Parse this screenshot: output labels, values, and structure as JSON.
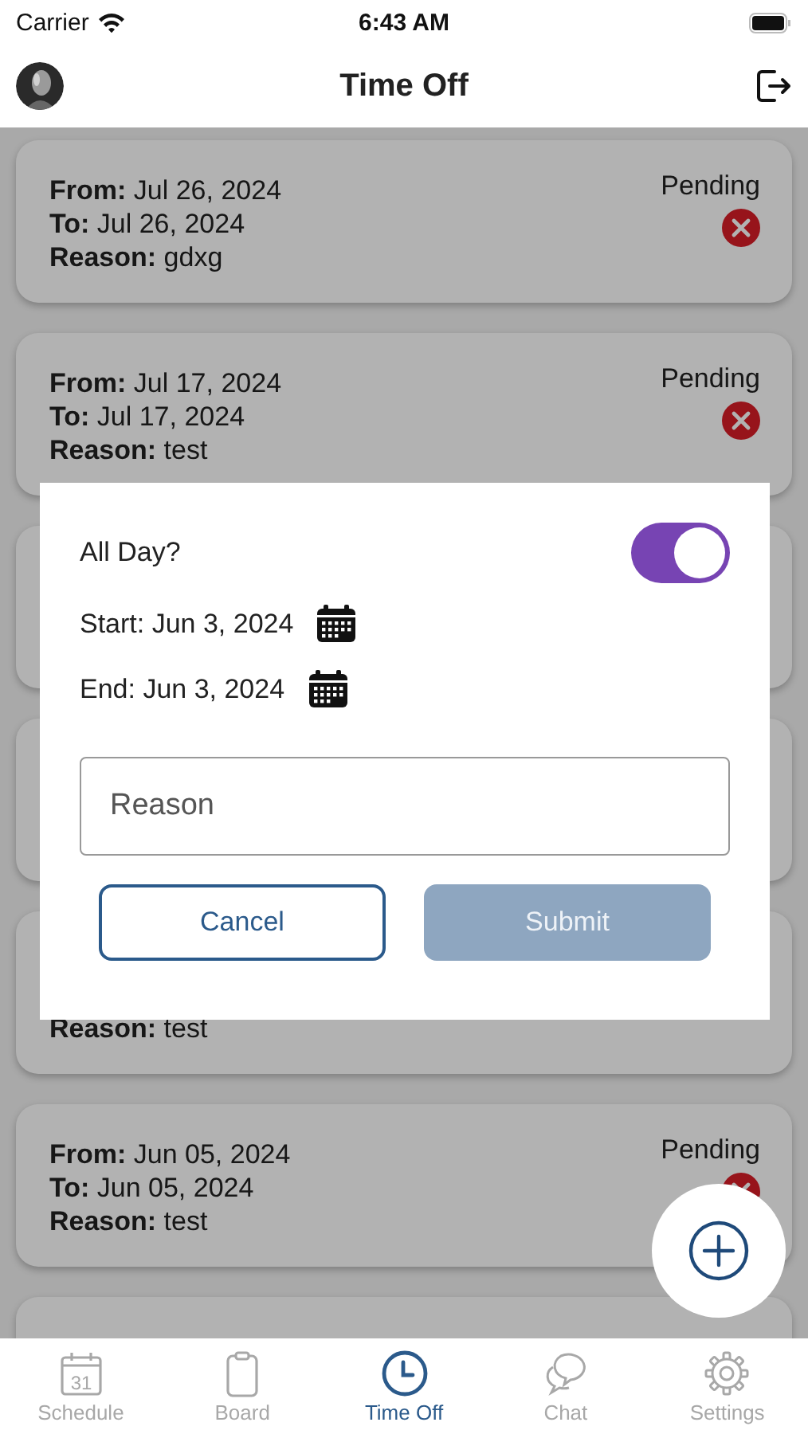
{
  "status_bar": {
    "carrier": "Carrier",
    "time": "6:43 AM"
  },
  "header": {
    "title": "Time Off"
  },
  "requests": [
    {
      "kind": "request",
      "lines": [
        "**From:** Jul 26, 2024",
        "**To:** Jul 26, 2024",
        "**Reason:** gdxg"
      ],
      "status": "Pending",
      "cancellable": true
    },
    {
      "kind": "request",
      "lines": [
        "**From:** Jul 17, 2024",
        "**To:** Jul 17, 2024",
        "**Reason:** test"
      ],
      "status": "Pending",
      "cancellable": true
    },
    {
      "kind": "blank"
    },
    {
      "kind": "blank"
    },
    {
      "kind": "request",
      "lines": [
        "**Reason:** test"
      ]
    },
    {
      "kind": "request",
      "lines": [
        "**From:** Jun 05, 2024",
        "**To:** Jun 05, 2024",
        "**Reason:** test"
      ],
      "status": "Pending",
      "cancellable": true
    },
    {
      "kind": "blank"
    }
  ],
  "dialog": {
    "all_day": {
      "label": "All Day?",
      "on": true
    },
    "start": "Start: Jun 3, 2024",
    "end": "End: Jun 3, 2024",
    "reason": {
      "placeholder": "Reason"
    },
    "buttons": [
      {
        "label": "Cancel",
        "kind": "outline",
        "disabled": false
      },
      {
        "label": "Submit",
        "kind": "filled",
        "disabled": true
      }
    ]
  },
  "tabs": [
    {
      "label": "Schedule",
      "selected": false,
      "icon_label": "31"
    },
    {
      "label": "Board",
      "selected": false
    },
    {
      "label": "Time Off",
      "selected": true
    },
    {
      "label": "Chat",
      "selected": false
    },
    {
      "label": "Settings",
      "selected": false
    }
  ]
}
